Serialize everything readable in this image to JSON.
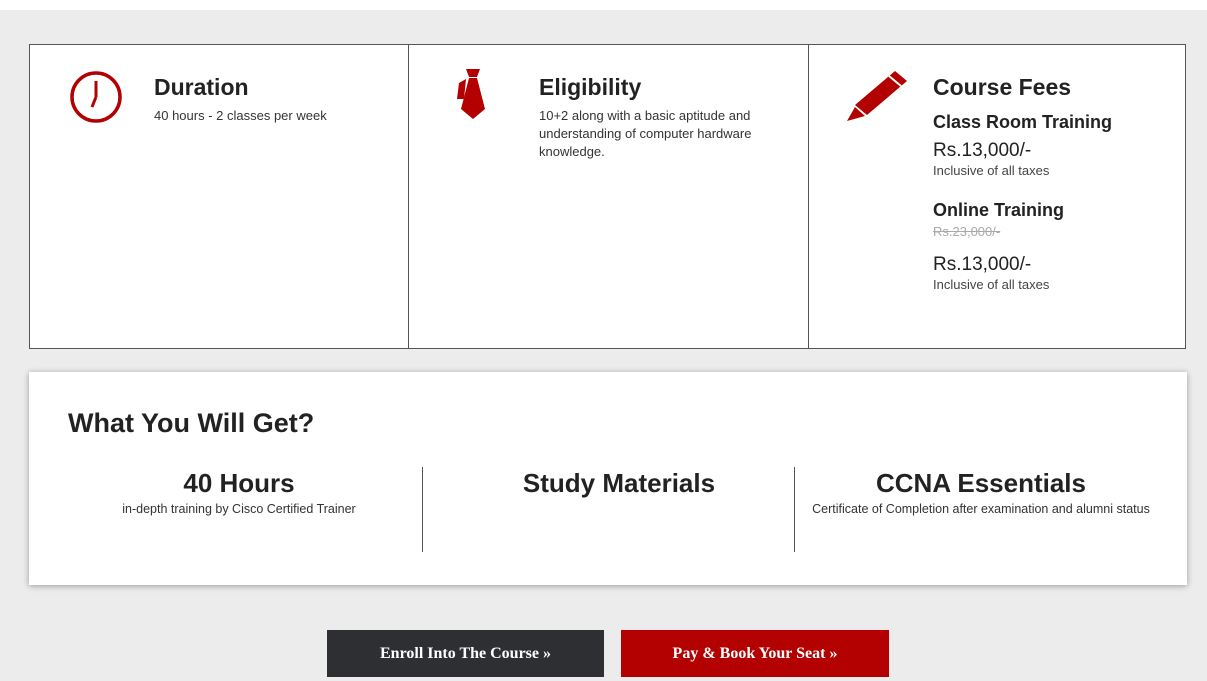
{
  "colors": {
    "accent": "#b30000",
    "dark_button": "#2d2f33"
  },
  "info": {
    "duration": {
      "icon": "clock-icon",
      "title": "Duration",
      "text": "40 hours - 2 classes per week"
    },
    "eligibility": {
      "icon": "necktie-icon",
      "title": "Eligibility",
      "text": "10+2 along with a basic aptitude and understanding of computer hardware knowledge."
    },
    "fees": {
      "icon": "pencil-icon",
      "title": "Course Fees",
      "classroom": {
        "label": "Class Room Training",
        "price": "Rs.13,000/-",
        "note": "Inclusive of all taxes"
      },
      "online": {
        "label": "Online Training",
        "old_price": "Rs.23,000/-",
        "price": "Rs.13,000/-",
        "note": "Inclusive of all taxes"
      }
    }
  },
  "get": {
    "title": "What You Will Get?",
    "items": [
      {
        "head": "40 Hours",
        "text": "in-depth training by Cisco Certified Trainer"
      },
      {
        "head": "Study Materials",
        "text": ""
      },
      {
        "head": "CCNA Essentials",
        "text": "Certificate of Completion after examination and alumni status"
      }
    ]
  },
  "buttons": {
    "enroll": "Enroll Into The Course »",
    "pay": "Pay & Book Your Seat »"
  }
}
